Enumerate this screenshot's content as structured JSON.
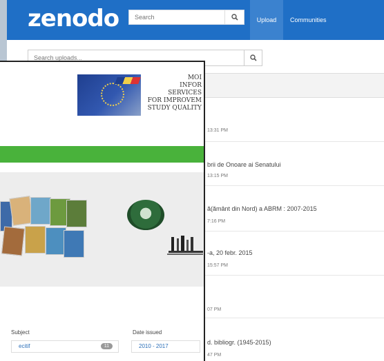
{
  "zenodo": {
    "logo": "zenodo",
    "search": {
      "placeholder": "Search"
    },
    "nav": {
      "upload": "Upload",
      "communities": "Communities"
    },
    "uploads_search": {
      "placeholder": "Search uploads..."
    },
    "uploads": [
      {
        "title": "",
        "time": "13:31 PM"
      },
      {
        "title": "brii de Onoare ai Senatului",
        "time": "13:15 PM"
      },
      {
        "title": "ă(ământ din Nord) a ABRM : 2007-2015",
        "time": "7:16 PM"
      },
      {
        "title": "-a, 20 febr. 2015",
        "time": "15:57 PM"
      },
      {
        "title": "",
        "time": "07 PM"
      },
      {
        "title": "d. bibliogr. (1945-2015)",
        "time": "47 PM"
      }
    ]
  },
  "moisis": {
    "logo_text": [
      "MOI",
      "INFOR",
      "SERVICES",
      "FOR IMPROVEM",
      "STUDY QUALITY"
    ],
    "facets": {
      "subject_header": "Subject",
      "subject_item": "ecitif",
      "subject_count": "11",
      "date_header": "Date issued",
      "date_item": "2010 - 2017"
    }
  },
  "colors": {
    "zenodo_blue": "#1f6fc6",
    "upload_active": "#3b82cf",
    "green_bar": "#49b23b",
    "background": "#b9c6d3"
  }
}
